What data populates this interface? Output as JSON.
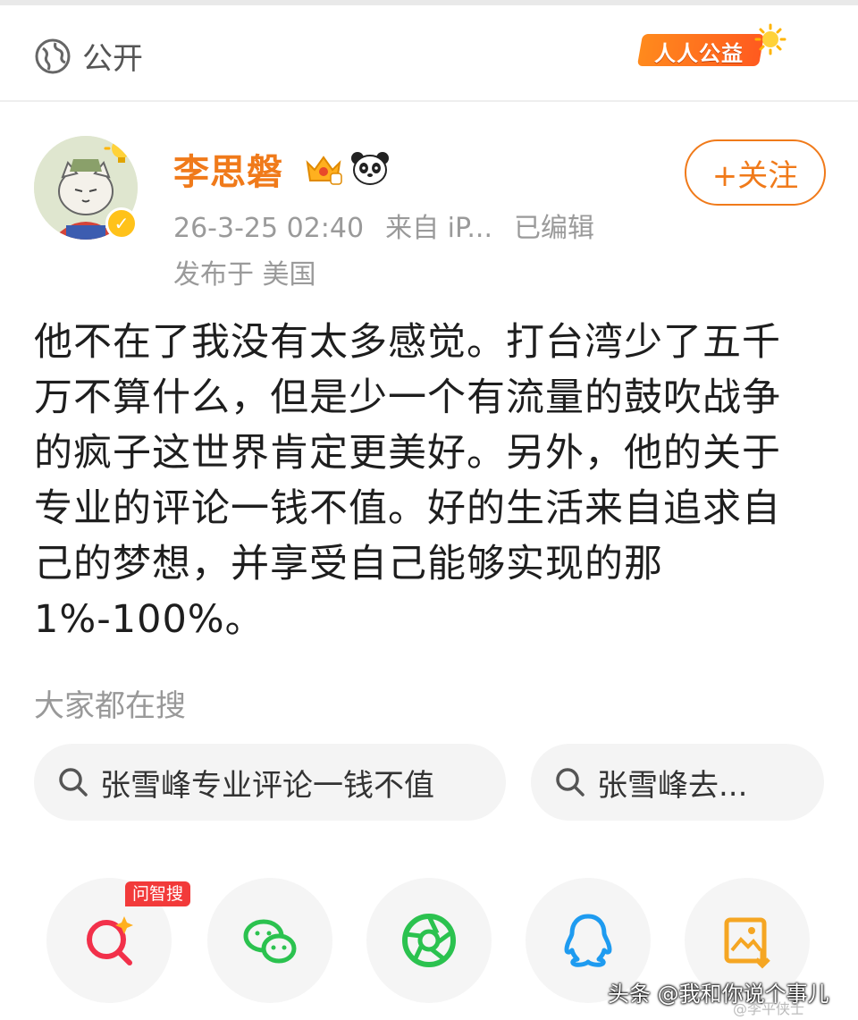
{
  "header": {
    "visibility_label": "公开",
    "charity_label": "人人公益"
  },
  "post": {
    "username": "李思磐",
    "timestamp": "26-3-25 02:40",
    "source": "来自 iP...",
    "edited": "已编辑",
    "location": "发布于 美国",
    "follow_label": "+关注",
    "content": "他不在了我没有太多感觉。打台湾少了五千万不算什么，但是少一个有流量的鼓吹战争的疯子这世界肯定更美好。另外，他的关于专业的评论一钱不值。好的生活来自追求自己的梦想，并享受自己能够实现的那1%-100%。"
  },
  "search": {
    "title": "大家都在搜",
    "chips": [
      {
        "label": "张雪峰专业评论一钱不值"
      },
      {
        "label": "张雪峰去..."
      }
    ]
  },
  "share": {
    "zhisou_badge": "问智搜",
    "items": [
      {
        "icon": "ai-search-icon"
      },
      {
        "icon": "wechat-icon"
      },
      {
        "icon": "moments-icon"
      },
      {
        "icon": "qq-icon"
      },
      {
        "icon": "save-image-icon"
      }
    ]
  },
  "watermark": {
    "text": "头条 @我和你说个事儿",
    "secondary": "@李平侠士"
  },
  "colors": {
    "accent": "#f07a1a",
    "verified": "#ffc21a",
    "wechat": "#2bc24f",
    "qq": "#1e9bf0",
    "badge_red": "#f23a3a"
  }
}
